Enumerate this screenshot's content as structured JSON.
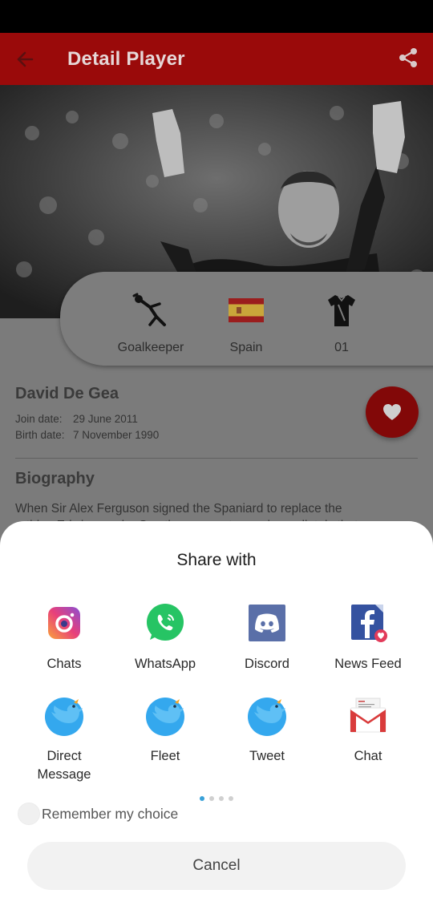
{
  "app_bar": {
    "title": "Detail Player"
  },
  "player": {
    "position": "Goalkeeper",
    "country": "Spain",
    "number": "01",
    "name": "David De Gea",
    "join_label": "Join date:",
    "join_value": "29 June 2011",
    "birth_label": "Birth date:",
    "birth_value": "7 November 1990",
    "bio_title": "Biography",
    "bio_line1": "When Sir Alex Ferguson signed the Spaniard to replace the",
    "bio_line2": "retiring Edwin van der Sar, the young stopper immediately that"
  },
  "share_sheet": {
    "title": "Share with",
    "apps": [
      {
        "label": "Chats",
        "icon": "instagram-icon"
      },
      {
        "label": "WhatsApp",
        "icon": "whatsapp-icon"
      },
      {
        "label": "Discord",
        "icon": "discord-icon"
      },
      {
        "label": "News Feed",
        "icon": "facebook-icon"
      },
      {
        "label": "Direct Message",
        "label_line1": "Direct",
        "label_line2": "Message",
        "icon": "twitter-icon"
      },
      {
        "label": "Fleet",
        "icon": "twitter-icon"
      },
      {
        "label": "Tweet",
        "icon": "twitter-icon"
      },
      {
        "label": "Chat",
        "icon": "gmail-icon"
      }
    ],
    "remember_label": "Remember my choice",
    "cancel_label": "Cancel"
  },
  "colors": {
    "primary": "#9a0a0a",
    "accent_dot": "#39a1d8"
  }
}
